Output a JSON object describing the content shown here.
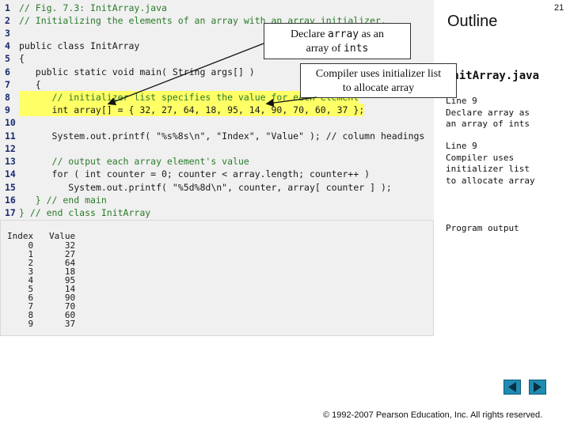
{
  "slide": {
    "number": "21",
    "outline_title": "Outline",
    "file_name": "InitArray.java",
    "side_notes": [
      [
        "Line 9",
        "Declare array as",
        "an array of ints"
      ],
      [
        "Line 9",
        "Compiler uses",
        "initializer list",
        "to allocate array"
      ],
      [
        "Program output"
      ]
    ],
    "copyright": "© 1992-2007 Pearson Education, Inc.  All rights reserved.",
    "nav_prev_icon": "triangle-left-icon",
    "nav_next_icon": "triangle-right-icon"
  },
  "code": {
    "lines": [
      {
        "num": "1",
        "text": "// Fig. 7.3: InitArray.java"
      },
      {
        "num": "2",
        "text": "// Initializing the elements of an array with an array initializer."
      },
      {
        "num": "3",
        "text": ""
      },
      {
        "num": "4",
        "text": "public class InitArray"
      },
      {
        "num": "5",
        "text": "{"
      },
      {
        "num": "6",
        "text": "   public static void main( String args[] )"
      },
      {
        "num": "7",
        "text": "   {"
      },
      {
        "num": "8",
        "text": "      // initializer list specifies the value for each element"
      },
      {
        "num": "9",
        "text": "      int array[] = { 32, 27, 64, 18, 95, 14, 90, 70, 60, 37 };"
      },
      {
        "num": "10",
        "text": ""
      },
      {
        "num": "11",
        "text": "      System.out.printf( \"%s%8s\\n\", \"Index\", \"Value\" ); // column headings"
      },
      {
        "num": "12",
        "text": ""
      },
      {
        "num": "13",
        "text": "      // output each array element's value"
      },
      {
        "num": "14",
        "text": "      for ( int counter = 0; counter < array.length; counter++ )"
      },
      {
        "num": "15",
        "text": "         System.out.printf( \"%5d%8d\\n\", counter, array[ counter ] );"
      },
      {
        "num": "16",
        "text": "   } // end main"
      },
      {
        "num": "17",
        "text": "} // end class InitArray"
      }
    ]
  },
  "output": {
    "header": "Index   Value",
    "rows": [
      "    0      32",
      "    1      27",
      "    2      64",
      "    3      18",
      "    4      95",
      "    5      14",
      "    6      90",
      "    7      70",
      "    8      60",
      "    9      37"
    ]
  },
  "callouts": {
    "declare": {
      "pre": "Declare ",
      "mono": "array",
      "post": " as an",
      "line2": "array of ",
      "mono2": "ints"
    },
    "compiler": {
      "line1": "Compiler uses initializer list",
      "line2": "to allocate array"
    }
  },
  "colors": {
    "highlight": "#ffff66",
    "keyword": "#1e3a9e",
    "comment": "#2a7a2a",
    "nav_button": "#1f8bb0"
  }
}
